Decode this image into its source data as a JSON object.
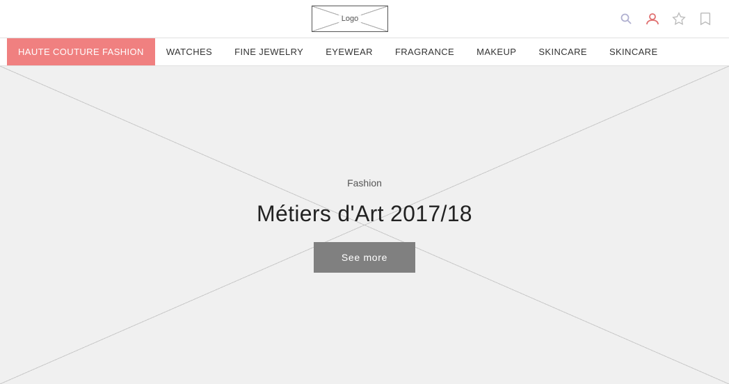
{
  "header": {
    "logo_text": "Logo",
    "icons": {
      "search": "🔍",
      "user": "👤",
      "star": "☆",
      "bookmark": "🔖"
    }
  },
  "nav": {
    "items": [
      {
        "id": "haute-couture",
        "label": "HAUTE COUTURE  FASHION",
        "active": true
      },
      {
        "id": "watches",
        "label": "WATCHES",
        "active": false
      },
      {
        "id": "fine-jewelry",
        "label": "FINE JEWELRY",
        "active": false
      },
      {
        "id": "eyewear",
        "label": "EYEWEAR",
        "active": false
      },
      {
        "id": "fragrance",
        "label": "FRAGRANCE",
        "active": false
      },
      {
        "id": "makeup",
        "label": "MAKEUP",
        "active": false
      },
      {
        "id": "skincare1",
        "label": "SKINCARE",
        "active": false
      },
      {
        "id": "skincare2",
        "label": "SKINCARE",
        "active": false
      }
    ]
  },
  "hero": {
    "category": "Fashion",
    "title": "Métiers d'Art 2017/18",
    "cta_label": "See more"
  }
}
